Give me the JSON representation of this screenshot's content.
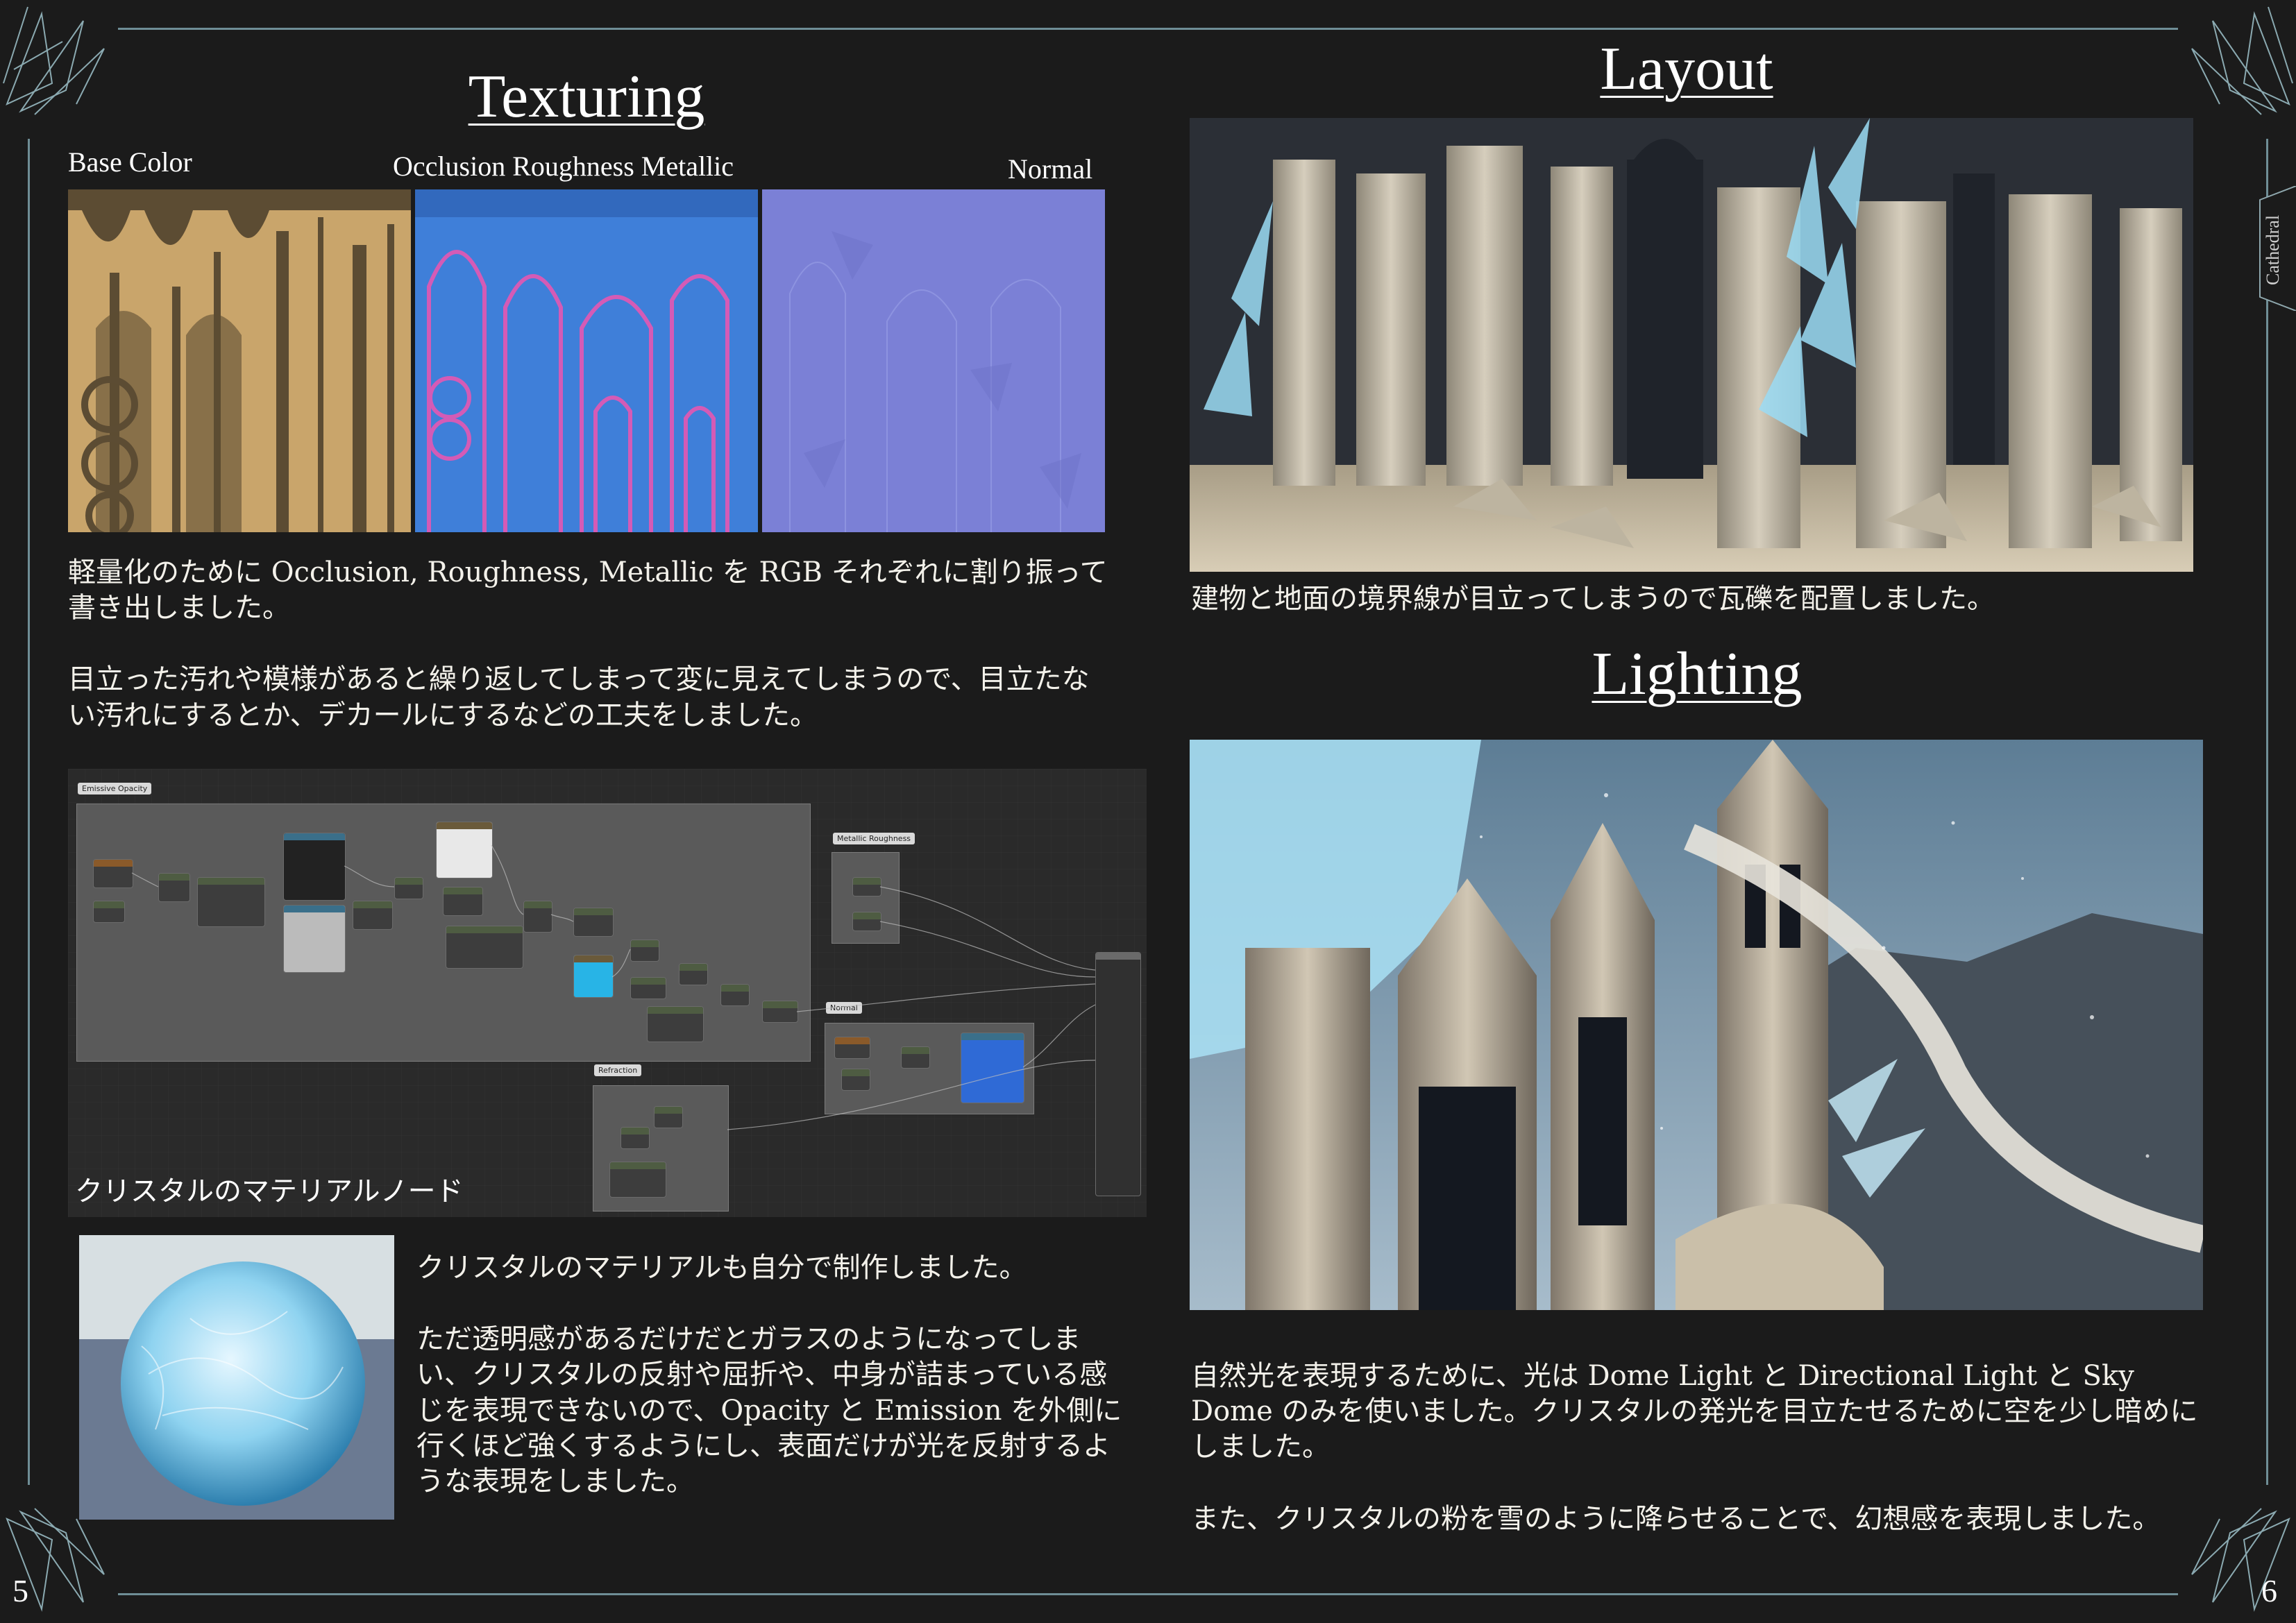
{
  "sections": {
    "texturing": {
      "title": "Texturing",
      "labels": {
        "base_color": "Base Color",
        "orm": "Occlusion Roughness Metallic",
        "normal": "Normal"
      },
      "paragraphs": [
        "軽量化のために Occlusion, Roughness, Metallic を RGB それぞれに割り振って書き出しました。",
        "目立った汚れや模様があると繰り返してしまって変に見えてしまうので、目立たない汚れにするとか、デカールにするなどの工夫をしました。"
      ],
      "node_graph": {
        "caption": "クリスタルのマテリアルノード",
        "groups": [
          "Emissive Opacity",
          "Metallic Roughness",
          "Normal",
          "Refraction"
        ]
      },
      "crystal_paragraphs": [
        "クリスタルのマテリアルも自分で制作しました。",
        "ただ透明感があるだけだとガラスのようになってしまい、クリスタルの反射や屈折や、中身が詰まっている感じを表現できないので、Opacity と Emission を外側に行くほど強くするようにし、表面だけが光を反射するような表現をしました。"
      ]
    },
    "layout": {
      "title": "Layout",
      "caption": "建物と地面の境界線が目立ってしまうので瓦礫を配置しました。"
    },
    "lighting": {
      "title": "Lighting",
      "paragraphs": [
        "自然光を表現するために、光は Dome Light と Directional Light と Sky Dome のみを使いました。クリスタルの発光を目立たせるために空を少し暗めにしました。",
        "また、クリスタルの粉を雪のように降らせることで、幻想感を表現しました。"
      ]
    }
  },
  "side_tab": "Cathedral",
  "page_numbers": {
    "left": "5",
    "right": "6"
  },
  "colors": {
    "background": "#1b1b1b",
    "frame": "#6f8e96",
    "base_color": "#c9a56b",
    "orm": "#3f7fd9",
    "normal": "#7b80d6",
    "crystal": "#8fd3f0"
  }
}
